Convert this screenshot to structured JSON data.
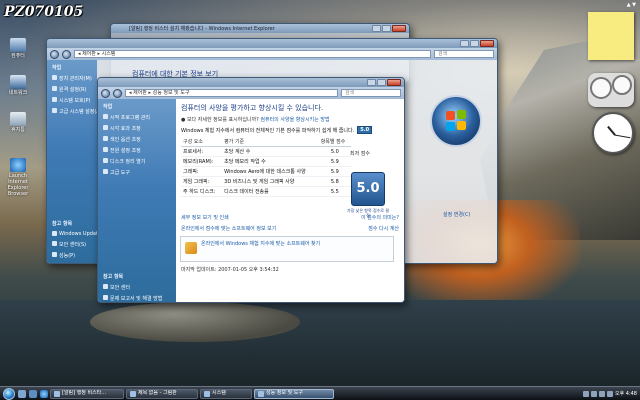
{
  "watermark": "PZ070105",
  "desktop_icons": [
    {
      "label": "컴퓨터"
    },
    {
      "label": "네트워크"
    },
    {
      "label": "휴지통"
    },
    {
      "label": "Launch Internet Explorer Browser"
    },
    {
      "label": "Windows Update"
    }
  ],
  "gadgets": {
    "sidebar_control": "▲ ▼"
  },
  "ie_window": {
    "title": "[알림] 행정 비스터 설치 해봤습니다 - Windows Internet Explorer"
  },
  "sys_window": {
    "address": "◂ 제어판 ▸ 시스템",
    "search_placeholder": "검색",
    "heading": "컴퓨터에 대한 기본 정보 보기",
    "left_header": "작업",
    "left_items": [
      "장치 관리자(M)",
      "원격 설정(R)",
      "시스템 보호(P)",
      "고급 시스템 설정(A)"
    ],
    "see_also_header": "참고 항목",
    "see_also_items": [
      "Windows Update",
      "보안 센터(S)",
      "성능(P)"
    ],
    "change_settings": "설정 변경(C)"
  },
  "main_window": {
    "address": "◂ 제어판 ▸ 성능 정보 및 도구",
    "search_placeholder": "검색",
    "left_header": "작업",
    "left_items": [
      "시작 프로그램 관리",
      "시각 효과 조정",
      "색인 옵션 조정",
      "전원 설정 조정",
      "디스크 정리 열기",
      "고급 도구"
    ],
    "see_also_header": "참고 항목",
    "see_also_items": [
      "보안 센터",
      "문제 보고서 및 해결 방법"
    ],
    "heading": "컴퓨터의 사양을 평가하고 향상시킬 수 있습니다.",
    "sub": "● 보다 자세한 정보를 표시하십니까?",
    "sub_link": "컴퓨터의 사양을 향상시키는 방법",
    "score_line": "Windows 체험 지수에서 컴퓨터의 전체적인 기본 점수를 파악하기 쉽게 해 줍니다.",
    "score_line_badge": "5.0",
    "table_headers": [
      "구성 요소",
      "평가 기준",
      "항목별 점수",
      "최저 점수"
    ],
    "rows": [
      {
        "component": "프로세서:",
        "criterion": "초당 계산 수",
        "score": "5.0"
      },
      {
        "component": "메모리(RAM):",
        "criterion": "초당 메모리 작업 수",
        "score": "5.9"
      },
      {
        "component": "그래픽:",
        "criterion": "Windows Aero에 대한 데스크톱 사양",
        "score": "5.9"
      },
      {
        "component": "게임 그래픽:",
        "criterion": "3D 비즈니스 및 게임 그래픽 사양",
        "score": "5.8"
      },
      {
        "component": "주 하드 디스크:",
        "criterion": "디스크 데이터 전송률",
        "score": "5.5"
      }
    ],
    "base_score": "5.0",
    "base_note": "가장 낮은 항목 점수로 결정",
    "link_details": "세부 정보 보기 및 인쇄",
    "link_meaning": "이 점수의 의미는?",
    "link_online": "온라인에서 점수에 맞는 소프트웨어 정보 보기",
    "link_recalc": "점수 다시 계산",
    "box_text": "온라인에서 Windows 체험 지수에 맞는 소프트웨어 찾기",
    "last_update": "마지막 업데이트: 2007-01-05 오후 3:54:32"
  },
  "taskbar": {
    "buttons": [
      {
        "label": "[알림] 행정 비스타...",
        "active": false
      },
      {
        "label": "제목 없음 - 그림판",
        "active": false
      },
      {
        "label": "시스템",
        "active": false
      },
      {
        "label": "성능 정보 및 도구",
        "active": true
      }
    ],
    "clock": "오후 4:48"
  }
}
